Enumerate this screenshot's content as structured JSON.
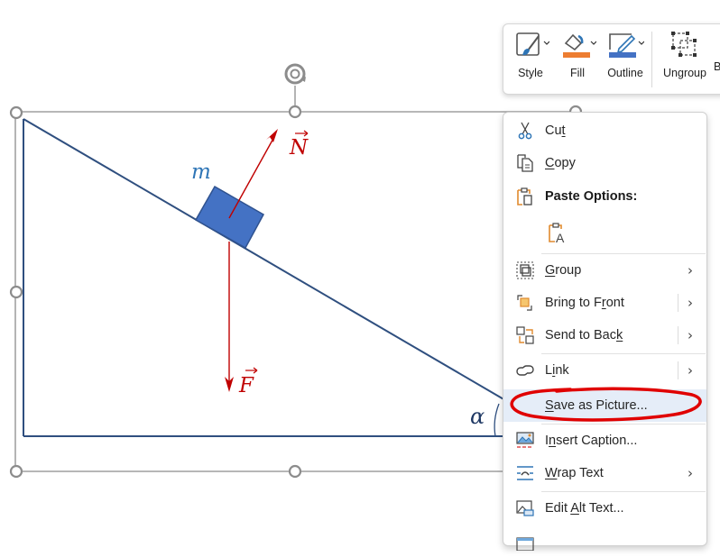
{
  "diagram": {
    "mass_label": "m",
    "normal_force_label": "N",
    "gravity_force_label": "F",
    "angle_label": "α",
    "colors": {
      "incline": "#2f4f7f",
      "block_fill": "#4472c4",
      "block_stroke": "#2f528f",
      "force": "#c00000",
      "mass_label": "#2e75b6",
      "angle_label": "#1f3864",
      "selection": "#8c8c8c"
    }
  },
  "mini_toolbar": {
    "buttons": [
      {
        "label": "Style",
        "icon": "shape-style-icon",
        "has_dropdown": true
      },
      {
        "label": "Fill",
        "icon": "paint-bucket-icon",
        "has_dropdown": true,
        "swatch": "#ed7d31"
      },
      {
        "label": "Outline",
        "icon": "pen-outline-icon",
        "has_dropdown": true,
        "swatch": "#4472c4"
      },
      {
        "label": "Ungroup",
        "icon": "ungroup-icon",
        "has_dropdown": false
      }
    ],
    "truncated_next_label": "B"
  },
  "context_menu": {
    "items": [
      {
        "label": "Cut",
        "mnemonic": "t",
        "icon": "scissors-icon"
      },
      {
        "label": "Copy",
        "mnemonic": "C",
        "icon": "copy-icon"
      },
      {
        "label": "Paste Options:",
        "icon": "paste-icon",
        "bold": true
      },
      {
        "label": "",
        "icon": "paste-keep-text-only-icon"
      },
      {
        "label": "Group",
        "mnemonic": "G",
        "icon": "group-icon",
        "submenu": true
      },
      {
        "label": "Bring to Front",
        "mnemonic": "r",
        "icon": "bring-to-front-icon",
        "submenu": true,
        "split": true
      },
      {
        "label": "Send to Back",
        "mnemonic": "k",
        "icon": "send-to-back-icon",
        "submenu": true,
        "split": true
      },
      {
        "label": "Link",
        "mnemonic": "i",
        "icon": "link-icon",
        "submenu": true,
        "split": true
      },
      {
        "label": "Save as Picture...",
        "mnemonic": "S",
        "icon": "",
        "highlighted": true,
        "annotated": true
      },
      {
        "label": "Insert Caption...",
        "mnemonic": "n",
        "icon": "insert-caption-icon"
      },
      {
        "label": "Wrap Text",
        "mnemonic": "W",
        "icon": "wrap-text-icon",
        "submenu": true
      },
      {
        "label": "Edit Alt Text...",
        "mnemonic": "A",
        "icon": "edit-alt-text-icon"
      }
    ],
    "parts": {
      "cut": [
        "Cu",
        "t",
        ""
      ],
      "copy": [
        "",
        "C",
        "opy"
      ],
      "group": [
        "",
        "G",
        "roup"
      ],
      "bring": [
        "Bring to F",
        "r",
        "ont"
      ],
      "send": [
        "Send to Bac",
        "k",
        ""
      ],
      "link": [
        "L",
        "i",
        "nk"
      ],
      "save": [
        "",
        "S",
        "ave as Picture..."
      ],
      "caption": [
        "I",
        "n",
        "sert Caption..."
      ],
      "wrap": [
        "",
        "W",
        "rap Text"
      ],
      "alt": [
        "Edit ",
        "A",
        "lt Text..."
      ]
    },
    "paste_header": "Paste Options:",
    "submenu_arrow": "›",
    "highlight_color": "#e5edf8",
    "annotation_color": "#e00000"
  }
}
